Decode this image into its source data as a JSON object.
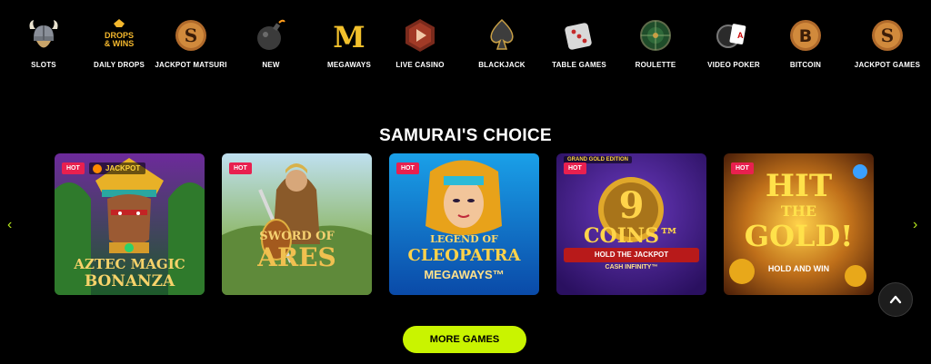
{
  "categories": [
    {
      "label": "SLOTS",
      "icon": "viking-helmet-icon"
    },
    {
      "label": "DAILY DROPS",
      "icon": "drops-wins-icon",
      "icon_text": "DROPS & WINS"
    },
    {
      "label": "JACKPOT MATSURI",
      "icon": "jackpot-s-coin-icon",
      "icon_text": "S"
    },
    {
      "label": "NEW",
      "icon": "bomb-icon"
    },
    {
      "label": "MEGAWAYS",
      "icon": "megaways-m-icon",
      "icon_text": "M"
    },
    {
      "label": "LIVE CASINO",
      "icon": "play-button-icon"
    },
    {
      "label": "BLACKJACK",
      "icon": "spade-icon"
    },
    {
      "label": "TABLE GAMES",
      "icon": "dice-icon"
    },
    {
      "label": "ROULETTE",
      "icon": "roulette-icon"
    },
    {
      "label": "VIDEO POKER",
      "icon": "poker-cards-icon"
    },
    {
      "label": "BITCOIN",
      "icon": "bitcoin-icon",
      "icon_text": "B"
    },
    {
      "label": "JACKPOT GAMES",
      "icon": "jackpot-s-coin-icon",
      "icon_text": "S"
    }
  ],
  "section_title": "SAMURAI'S CHOICE",
  "games": [
    {
      "name": "AZTEC MAGIC BONANZA",
      "line1": "AZTEC MAGIC",
      "line2": "BONANZA",
      "badge": "HOT",
      "jackpot": "JACKPOT"
    },
    {
      "name": "SWORD OF ARES",
      "line1": "SWORD OF",
      "line2": "ARES",
      "badge": "HOT"
    },
    {
      "name": "LEGEND OF CLEOPATRA MEGAWAYS",
      "line1": "LEGEND OF",
      "line2": "CLEOPATRA",
      "line3": "MEGAWAYS™",
      "badge": "HOT"
    },
    {
      "name": "9 COINS",
      "line1": "9",
      "line2": "COINS™",
      "line3": "HOLD THE JACKPOT",
      "line4": "CASH INFINITY™",
      "top_tag": "GRAND GOLD EDITION",
      "badge": "HOT"
    },
    {
      "name": "HIT THE GOLD! HOLD AND WIN",
      "line1": "HIT",
      "line2": "THE",
      "line3": "GOLD!",
      "line4": "HOLD AND WIN",
      "badge": "HOT"
    }
  ],
  "nav": {
    "prev": "‹",
    "next": "›"
  },
  "more_games_label": "MORE GAMES",
  "colors": {
    "accent": "#c9f400",
    "hot_badge": "#e8204f",
    "background": "#000000"
  }
}
